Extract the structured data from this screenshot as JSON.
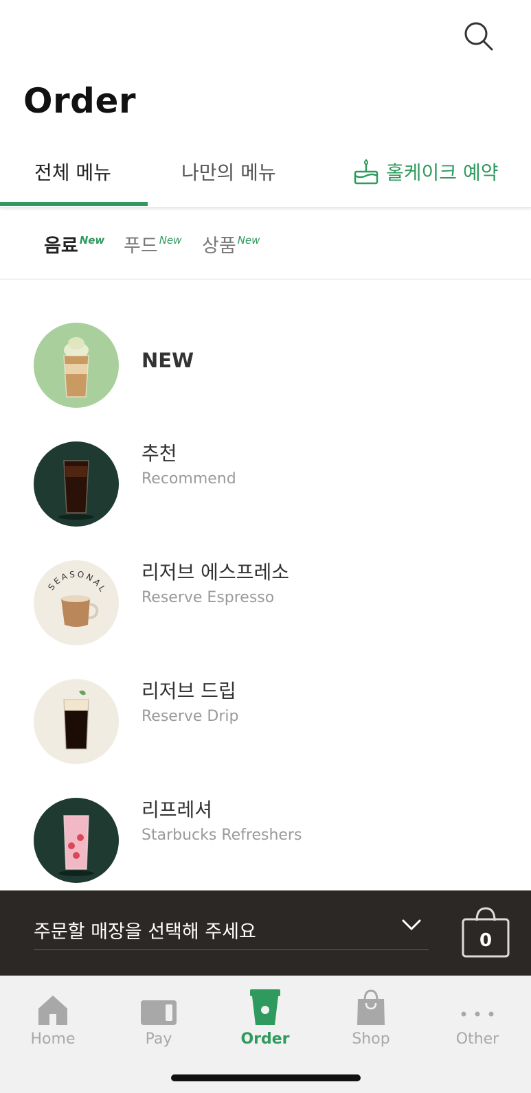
{
  "header": {
    "title": "Order"
  },
  "main_tabs": {
    "all": "전체 메뉴",
    "mine": "나만의 메뉴",
    "cake": "홀케이크 예약"
  },
  "sub_tabs": [
    {
      "label": "음료",
      "badge": "New"
    },
    {
      "label": "푸드",
      "badge": "New"
    },
    {
      "label": "상품",
      "badge": "New"
    }
  ],
  "categories": [
    {
      "ko": "NEW",
      "en": ""
    },
    {
      "ko": "추천",
      "en": "Recommend"
    },
    {
      "ko": "리저브 에스프레소",
      "en": "Reserve Espresso",
      "thumb_label": "SEASONAL"
    },
    {
      "ko": "리저브 드립",
      "en": "Reserve Drip"
    },
    {
      "ko": "리프레셔",
      "en": "Starbucks Refreshers"
    }
  ],
  "store_bar": {
    "prompt": "주문할 매장을 선택해 주세요",
    "cart_count": "0"
  },
  "bottom_nav": [
    {
      "label": "Home",
      "icon": "home-icon"
    },
    {
      "label": "Pay",
      "icon": "card-icon"
    },
    {
      "label": "Order",
      "icon": "cup-icon",
      "active": true
    },
    {
      "label": "Shop",
      "icon": "bag-icon"
    },
    {
      "label": "Other",
      "icon": "more-icon"
    }
  ],
  "colors": {
    "brand_green": "#2e9a5e",
    "dark_bar": "#2c2826",
    "dark_green": "#1f3b31",
    "light_green": "#a8cf9c"
  }
}
